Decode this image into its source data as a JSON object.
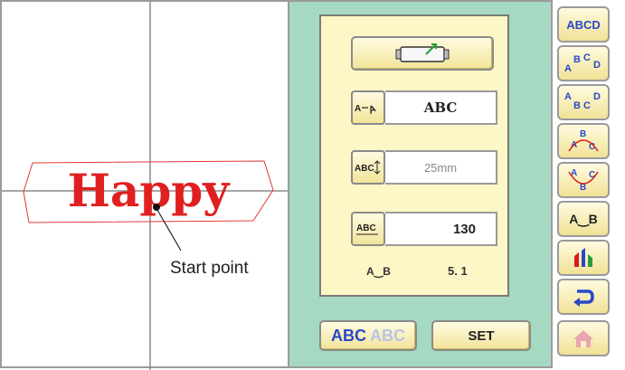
{
  "preview": {
    "sample_text": "Happy",
    "callout_label": "Start point",
    "text_color": "#e02020"
  },
  "panel": {
    "frame_button_icon": "frame-move-icon",
    "rotate_icon": "text-rotate-icon",
    "rotate_value": "ABC",
    "size_icon": "text-size-icon",
    "size_value": "25mm",
    "spacing_icon": "letter-spacing-icon",
    "spacing_value": "130",
    "spacing_label": "A‿B",
    "spacing_ratio": "5. 1",
    "font_icon_label": "ABC",
    "font_icon_label2": "ABC",
    "set_label": "SET"
  },
  "sidebar": {
    "items": [
      {
        "label": "ABCD"
      },
      {
        "label": "ABCD"
      },
      {
        "label": "ABCD"
      },
      {
        "label": "arc-spread-icon"
      },
      {
        "label": "arc-reverse-icon"
      },
      {
        "label": "A‿B"
      },
      {
        "label": "mirror-icon"
      },
      {
        "label": "back-icon"
      },
      {
        "label": "home-icon"
      }
    ]
  },
  "colors": {
    "panel_bg": "#a6d9c1",
    "inner_bg": "#fdf6c6",
    "accent_blue": "#2a48c8",
    "accent_red": "#d81c1c"
  }
}
